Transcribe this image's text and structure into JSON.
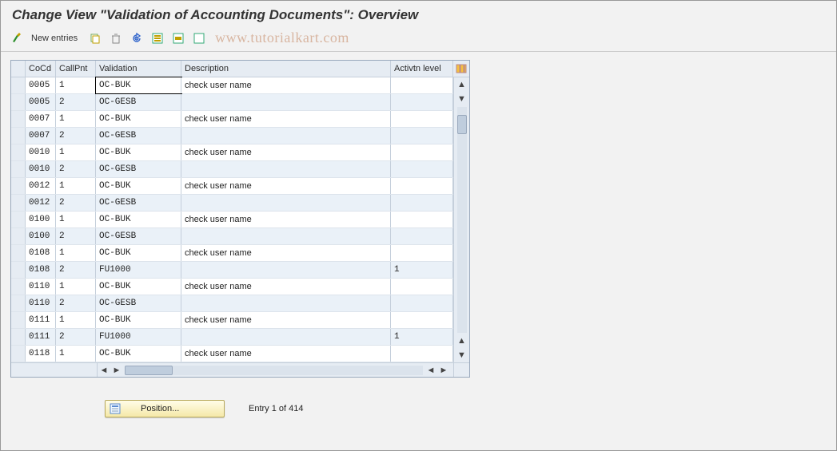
{
  "title": "Change View \"Validation of Accounting Documents\": Overview",
  "toolbar": {
    "new_entries_label": "New entries",
    "icons": {
      "details": "details-icon",
      "copy": "copy-icon",
      "delete": "delete-icon",
      "undo": "undo-icon",
      "select_all": "select-all-icon",
      "deselect_all": "deselect-all-icon",
      "export": "export-icon"
    }
  },
  "watermark": "www.tutorialkart.com",
  "table": {
    "headers": {
      "cocd": "CoCd",
      "callpnt": "CallPnt",
      "validation": "Validation",
      "description": "Description",
      "actlvl": "Activtn level"
    },
    "rows": [
      {
        "cocd": "0005",
        "callpnt": "1",
        "validation": "OC-BUK",
        "description": "check user name",
        "actlvl": ""
      },
      {
        "cocd": "0005",
        "callpnt": "2",
        "validation": "OC-GESB",
        "description": "",
        "actlvl": ""
      },
      {
        "cocd": "0007",
        "callpnt": "1",
        "validation": "OC-BUK",
        "description": "check user name",
        "actlvl": ""
      },
      {
        "cocd": "0007",
        "callpnt": "2",
        "validation": "OC-GESB",
        "description": "",
        "actlvl": ""
      },
      {
        "cocd": "0010",
        "callpnt": "1",
        "validation": "OC-BUK",
        "description": "check user name",
        "actlvl": ""
      },
      {
        "cocd": "0010",
        "callpnt": "2",
        "validation": "OC-GESB",
        "description": "",
        "actlvl": ""
      },
      {
        "cocd": "0012",
        "callpnt": "1",
        "validation": "OC-BUK",
        "description": "check user name",
        "actlvl": ""
      },
      {
        "cocd": "0012",
        "callpnt": "2",
        "validation": "OC-GESB",
        "description": "",
        "actlvl": ""
      },
      {
        "cocd": "0100",
        "callpnt": "1",
        "validation": "OC-BUK",
        "description": "check user name",
        "actlvl": ""
      },
      {
        "cocd": "0100",
        "callpnt": "2",
        "validation": "OC-GESB",
        "description": "",
        "actlvl": ""
      },
      {
        "cocd": "0108",
        "callpnt": "1",
        "validation": "OC-BUK",
        "description": "check user name",
        "actlvl": ""
      },
      {
        "cocd": "0108",
        "callpnt": "2",
        "validation": "FU1000",
        "description": "",
        "actlvl": "1"
      },
      {
        "cocd": "0110",
        "callpnt": "1",
        "validation": "OC-BUK",
        "description": "check user name",
        "actlvl": ""
      },
      {
        "cocd": "0110",
        "callpnt": "2",
        "validation": "OC-GESB",
        "description": "",
        "actlvl": ""
      },
      {
        "cocd": "0111",
        "callpnt": "1",
        "validation": "OC-BUK",
        "description": "check user name",
        "actlvl": ""
      },
      {
        "cocd": "0111",
        "callpnt": "2",
        "validation": "FU1000",
        "description": "",
        "actlvl": "1"
      },
      {
        "cocd": "0118",
        "callpnt": "1",
        "validation": "OC-BUK",
        "description": "check user name",
        "actlvl": ""
      }
    ]
  },
  "footer": {
    "position_label": "Position...",
    "entry_info": "Entry 1 of 414"
  }
}
